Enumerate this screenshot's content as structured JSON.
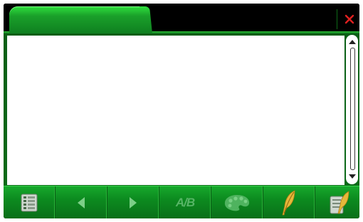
{
  "window": {
    "tabs": [
      {
        "label": "",
        "active": true
      }
    ],
    "close_icon": "close-x-icon",
    "close_color": "#e02020"
  },
  "content": {
    "text": "",
    "background": "#ffffff"
  },
  "scrollbar": {
    "up_icon": "scroll-up-icon",
    "down_icon": "scroll-down-icon"
  },
  "toolbar": {
    "accent": "#10901f",
    "buttons": [
      {
        "name": "list-icon",
        "enabled": true
      },
      {
        "name": "arrow-left-icon",
        "enabled": false
      },
      {
        "name": "arrow-right-icon",
        "enabled": false
      },
      {
        "name": "ab-compare-icon",
        "label": "A/B",
        "enabled": false
      },
      {
        "name": "palette-icon",
        "enabled": false
      },
      {
        "name": "feather-pen-icon",
        "enabled": true
      },
      {
        "name": "notes-pen-icon",
        "enabled": true
      }
    ]
  }
}
